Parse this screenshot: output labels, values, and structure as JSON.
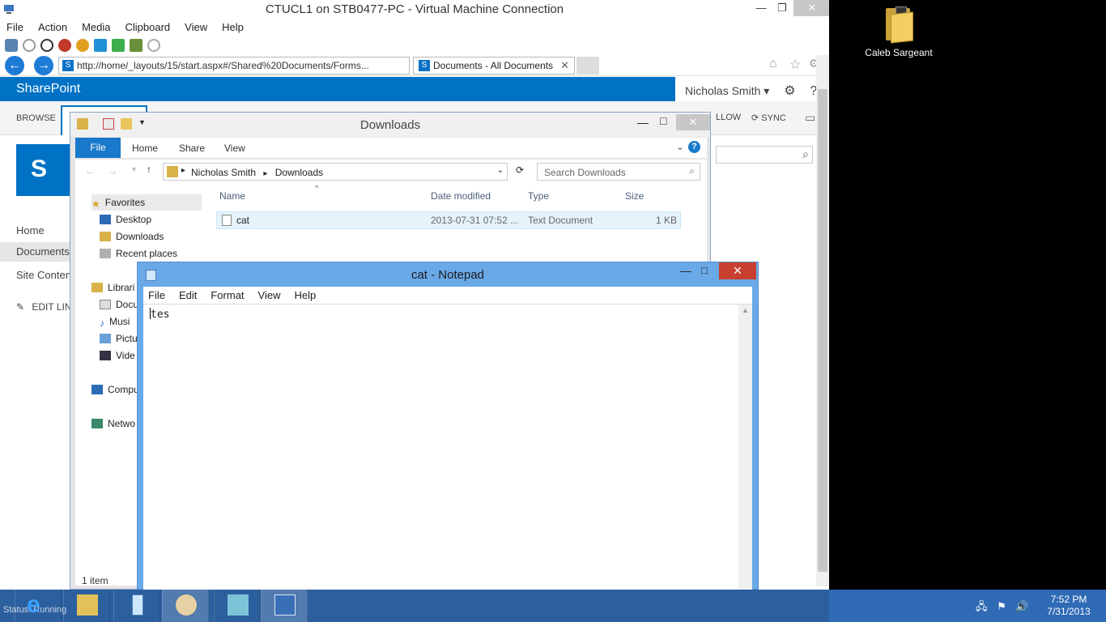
{
  "vm": {
    "title": "CTUCL1 on STB0477-PC - Virtual Machine Connection",
    "menu": [
      "File",
      "Action",
      "Media",
      "Clipboard",
      "View",
      "Help"
    ]
  },
  "browser": {
    "address": "http://home/_layouts/15/start.aspx#/Shared%20Documents/Forms...",
    "tab_title": "Documents - All Documents"
  },
  "sharepoint": {
    "brand": "SharePoint",
    "user": "Nicholas Smith ▾",
    "ribbon_browse": "BROWSE",
    "ribbon_follow": "LLOW",
    "ribbon_sync": "SYNC",
    "nav": [
      "Home",
      "Documents",
      "Site Conten",
      "EDIT LIN"
    ]
  },
  "explorer": {
    "title": "Downloads",
    "tabs": [
      "File",
      "Home",
      "Share",
      "View"
    ],
    "breadcrumb": [
      "Nicholas Smith",
      "Downloads"
    ],
    "search_placeholder": "Search Downloads",
    "nav": {
      "favorites": "Favorites",
      "desktop": "Desktop",
      "downloads": "Downloads",
      "recent": "Recent places",
      "libraries": "Librari",
      "documents": "Docu",
      "music": "Musi",
      "pictures": "Pictu",
      "videos": "Vide",
      "computer": "Compu",
      "network": "Netwo"
    },
    "columns": [
      "Name",
      "Date modified",
      "Type",
      "Size"
    ],
    "files": [
      {
        "name": "cat",
        "modified": "2013-07-31 07:52 ...",
        "type": "Text Document",
        "size": "1 KB"
      }
    ],
    "status": "1 item"
  },
  "notepad": {
    "title": "cat - Notepad",
    "menu": [
      "File",
      "Edit",
      "Format",
      "View",
      "Help"
    ],
    "content": "tes"
  },
  "desktop": {
    "icon_label": "Caleb Sargeant"
  },
  "taskbar": {
    "status_text": "Status: Running",
    "time": "7:52 PM",
    "date": "7/31/2013"
  }
}
